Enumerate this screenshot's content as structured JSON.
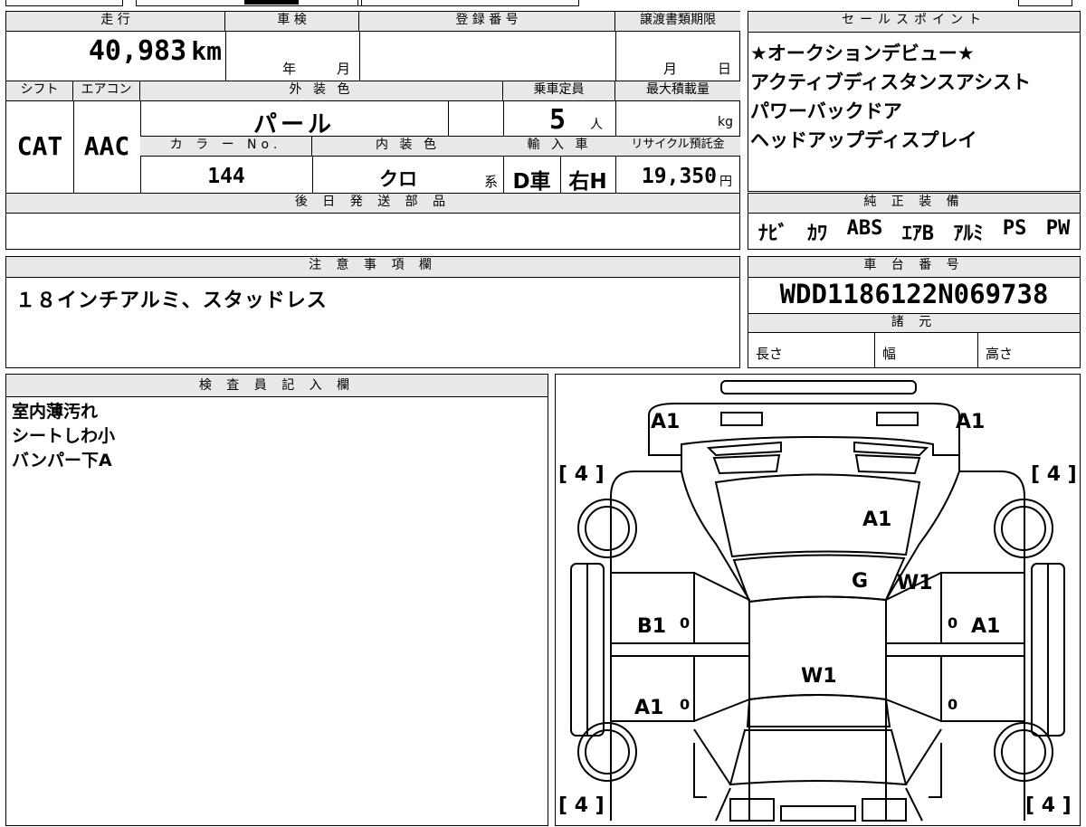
{
  "vehicle": {
    "mileage_label": "走 行",
    "mileage": "40,983",
    "mileage_unit": "km",
    "shaken_label": "車 検",
    "shaken_year": "年",
    "shaken_month": "月",
    "reg_label": "登 録 番 号",
    "transfer_label": "譲渡書類期限",
    "transfer_month": "月",
    "transfer_day": "日",
    "shift_label": "シフト",
    "shift": "CAT",
    "ac_label": "エアコン",
    "ac": "AAC",
    "exterior_label": "外 装 色",
    "exterior_color": "パール",
    "capacity_label": "乗車定員",
    "capacity": "5",
    "capacity_unit": "人",
    "load_label": "最大積載量",
    "load_unit": "kg",
    "color_no_label": "カ ラ ー No.",
    "color_no": "144",
    "interior_label": "内 装 色",
    "interior_color": "クロ",
    "interior_suffix": "系",
    "import_label": "輸 入 車",
    "import_type": "D車",
    "handle": "右H",
    "recycle_label": "リサイクル預託金",
    "recycle_fee": "19,350",
    "recycle_unit": "円",
    "later_parts_label": "後 日 発 送 部 品"
  },
  "sales_points": {
    "label": "セールスポイント",
    "lines": [
      "★オークションデビュー★",
      "アクティブディスタンスアシスト",
      "パワーバックドア",
      "ヘッドアップディスプレイ"
    ]
  },
  "equipment": {
    "label": "純 正 装 備",
    "items": [
      "ﾅﾋﾞ",
      "ｶﾜ",
      "ABS",
      "ｴｱB",
      "ｱﾙﾐ",
      "PS",
      "PW"
    ]
  },
  "notes": {
    "label": "注 意 事 項 欄",
    "text": "１８インチアルミ、スタッドレス"
  },
  "chassis": {
    "label": "車 台 番 号",
    "vin": "WDD1186122N069738",
    "spec_label": "諸 元",
    "length_label": "長さ",
    "width_label": "幅",
    "height_label": "高さ"
  },
  "inspector": {
    "label": "検 査 員 記 入 欄",
    "lines": [
      "室内薄汚れ",
      "シートしわ小",
      "バンパー下A"
    ]
  },
  "diagram": {
    "marks": {
      "front_left": "A1",
      "front_right": "A1",
      "hood": "A1",
      "windshield_g": "G",
      "windshield_w": "W1",
      "left_front_door": "B1",
      "right_front_door": "A1",
      "roof": "W1",
      "left_rear_door": "A1"
    },
    "tire_labels": [
      "[ 4 ]",
      "[ 4 ]",
      "[ 4 ]",
      "[ 4 ]"
    ],
    "zero_marks": [
      "0",
      "0",
      "0",
      "0"
    ]
  }
}
